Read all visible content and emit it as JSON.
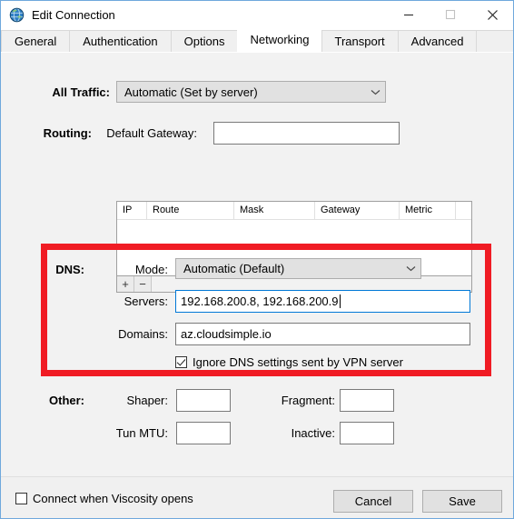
{
  "window": {
    "title": "Edit Connection",
    "icon": "globe-icon",
    "controls": {
      "minimize": "minimize-icon",
      "maximize": "maximize-icon",
      "close": "close-icon"
    }
  },
  "tabs": [
    {
      "label": "General",
      "selected": false
    },
    {
      "label": "Authentication",
      "selected": false
    },
    {
      "label": "Options",
      "selected": false
    },
    {
      "label": "Networking",
      "selected": true
    },
    {
      "label": "Transport",
      "selected": false
    },
    {
      "label": "Advanced",
      "selected": false
    }
  ],
  "all_traffic": {
    "label": "All Traffic:",
    "value": "Automatic (Set by server)"
  },
  "routing": {
    "label": "Routing:",
    "gateway_label": "Default Gateway:",
    "gateway_value": "",
    "columns": [
      "IP",
      "Route",
      "Mask",
      "Gateway",
      "Metric"
    ],
    "rows": [],
    "add_button": "+",
    "remove_button": "−"
  },
  "dns": {
    "label": "DNS:",
    "mode_label": "Mode:",
    "mode_value": "Automatic (Default)",
    "servers_label": "Servers:",
    "servers_value": "192.168.200.8, 192.168.200.9",
    "domains_label": "Domains:",
    "domains_value": "az.cloudsimple.io",
    "ignore_label": "Ignore DNS settings sent by VPN server",
    "ignore_checked": true,
    "highlight_color": "#f01c24"
  },
  "other": {
    "label": "Other:",
    "shaper_label": "Shaper:",
    "shaper_value": "",
    "fragment_label": "Fragment:",
    "fragment_value": "",
    "tun_mtu_label": "Tun MTU:",
    "tun_mtu_value": "",
    "inactive_label": "Inactive:",
    "inactive_value": ""
  },
  "footer": {
    "connect_label": "Connect when Viscosity opens",
    "connect_checked": false,
    "cancel_label": "Cancel",
    "save_label": "Save"
  }
}
